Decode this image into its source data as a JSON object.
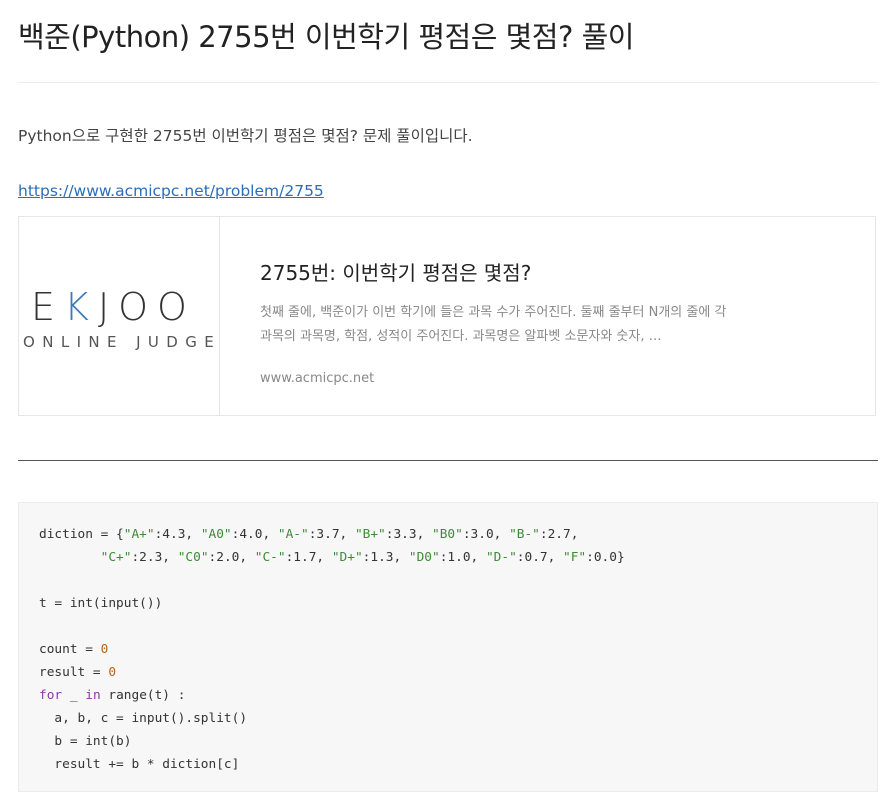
{
  "post": {
    "title": "백준(Python) 2755번 이번학기 평점은 몇점? 풀이",
    "intro": "Python으로 구현한 2755번 이번학기 평점은 몇점? 문제 풀이입니다.",
    "link": "https://www.acmicpc.net/problem/2755"
  },
  "card": {
    "logo_main_left": "E",
    "logo_main_k": "K",
    "logo_main_right": "JOO",
    "logo_sub": "ONLINE JUDGE",
    "title": "2755번: 이번학기 평점은 몇점?",
    "description": "첫째 줄에, 백준이가 이번 학기에 들은 과목 수가 주어진다. 둘째 줄부터 N개의 줄에 각 과목의 과목명, 학점, 성적이 주어진다. 과목명은 알파벳 소문자와 숫자, …",
    "domain": "www.acmicpc.net"
  },
  "code": {
    "lines": [
      [
        [
          "p",
          "diction = {"
        ],
        [
          "s",
          "\"A+\""
        ],
        [
          "p",
          ":4.3, "
        ],
        [
          "s",
          "\"A0\""
        ],
        [
          "p",
          ":4.0, "
        ],
        [
          "s",
          "\"A-\""
        ],
        [
          "p",
          ":3.7, "
        ],
        [
          "s",
          "\"B+\""
        ],
        [
          "p",
          ":3.3, "
        ],
        [
          "s",
          "\"B0\""
        ],
        [
          "p",
          ":3.0, "
        ],
        [
          "s",
          "\"B-\""
        ],
        [
          "p",
          ":2.7,"
        ]
      ],
      [
        [
          "p",
          "        "
        ],
        [
          "s",
          "\"C+\""
        ],
        [
          "p",
          ":2.3, "
        ],
        [
          "s",
          "\"C0\""
        ],
        [
          "p",
          ":2.0, "
        ],
        [
          "s",
          "\"C-\""
        ],
        [
          "p",
          ":1.7, "
        ],
        [
          "s",
          "\"D+\""
        ],
        [
          "p",
          ":1.3, "
        ],
        [
          "s",
          "\"D0\""
        ],
        [
          "p",
          ":1.0, "
        ],
        [
          "s",
          "\"D-\""
        ],
        [
          "p",
          ":0.7, "
        ],
        [
          "s",
          "\"F\""
        ],
        [
          "p",
          ":0.0}"
        ]
      ],
      [],
      [
        [
          "p",
          "t = int(input())"
        ]
      ],
      [],
      [
        [
          "p",
          "count = "
        ],
        [
          "n",
          "0"
        ]
      ],
      [
        [
          "p",
          "result = "
        ],
        [
          "n",
          "0"
        ]
      ],
      [
        [
          "k",
          "for"
        ],
        [
          "p",
          " _ "
        ],
        [
          "k",
          "in"
        ],
        [
          "p",
          " range(t) :"
        ]
      ],
      [
        [
          "p",
          "  a, b, c = input().split()"
        ]
      ],
      [
        [
          "p",
          "  b = int(b)"
        ]
      ],
      [
        [
          "p",
          "  result += b * diction[c]"
        ]
      ]
    ]
  },
  "colors": {
    "link": "#2a6ebb",
    "logo_accent": "#3a7bbf",
    "code_string": "#3f8a3a",
    "code_number": "#b5651d",
    "code_keyword": "#8b3aa8",
    "code_background": "#f7f7f7"
  }
}
